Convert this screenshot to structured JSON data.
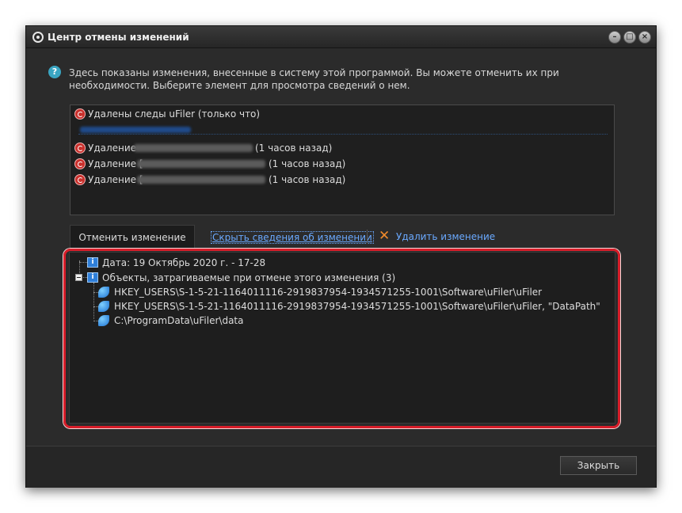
{
  "window": {
    "title": "Центр отмены изменений"
  },
  "description": "Здесь показаны изменения, внесенные в систему этой программой. Вы можете отменить их при необходимости. Выберите элемент для просмотра сведений о нем.",
  "changes": {
    "items": [
      {
        "label": "Удалены следы uFiler (только что)"
      },
      {
        "label": "Удаление",
        "suffix": "(1 часов назад)"
      },
      {
        "label": "Удаление [",
        "suffix": "(1 часов назад)"
      },
      {
        "label": "Удаление [",
        "suffix": "(1 часов назад)"
      }
    ]
  },
  "actions": {
    "undo_tab": "Отменить изменение",
    "hide_details": "Скрыть сведения об изменении",
    "delete_change": "Удалить изменение"
  },
  "details": {
    "date": "Дата: 19 Октябрь 2020 г. - 17-28",
    "objects_header": "Объекты, затрагиваемые при отмене этого изменения (3)",
    "objects": [
      "HKEY_USERS\\S-1-5-21-1164011116-2919837954-1934571255-1001\\Software\\uFiler\\uFiler",
      "HKEY_USERS\\S-1-5-21-1164011116-2919837954-1934571255-1001\\Software\\uFiler\\uFiler, \"DataPath\"",
      "C:\\ProgramData\\uFiler\\data"
    ]
  },
  "footer": {
    "close_label": "Закрыть"
  },
  "colors": {
    "highlight": "#d81e2a",
    "link": "#6aa9ff",
    "undo_icon": "#c9302c"
  }
}
